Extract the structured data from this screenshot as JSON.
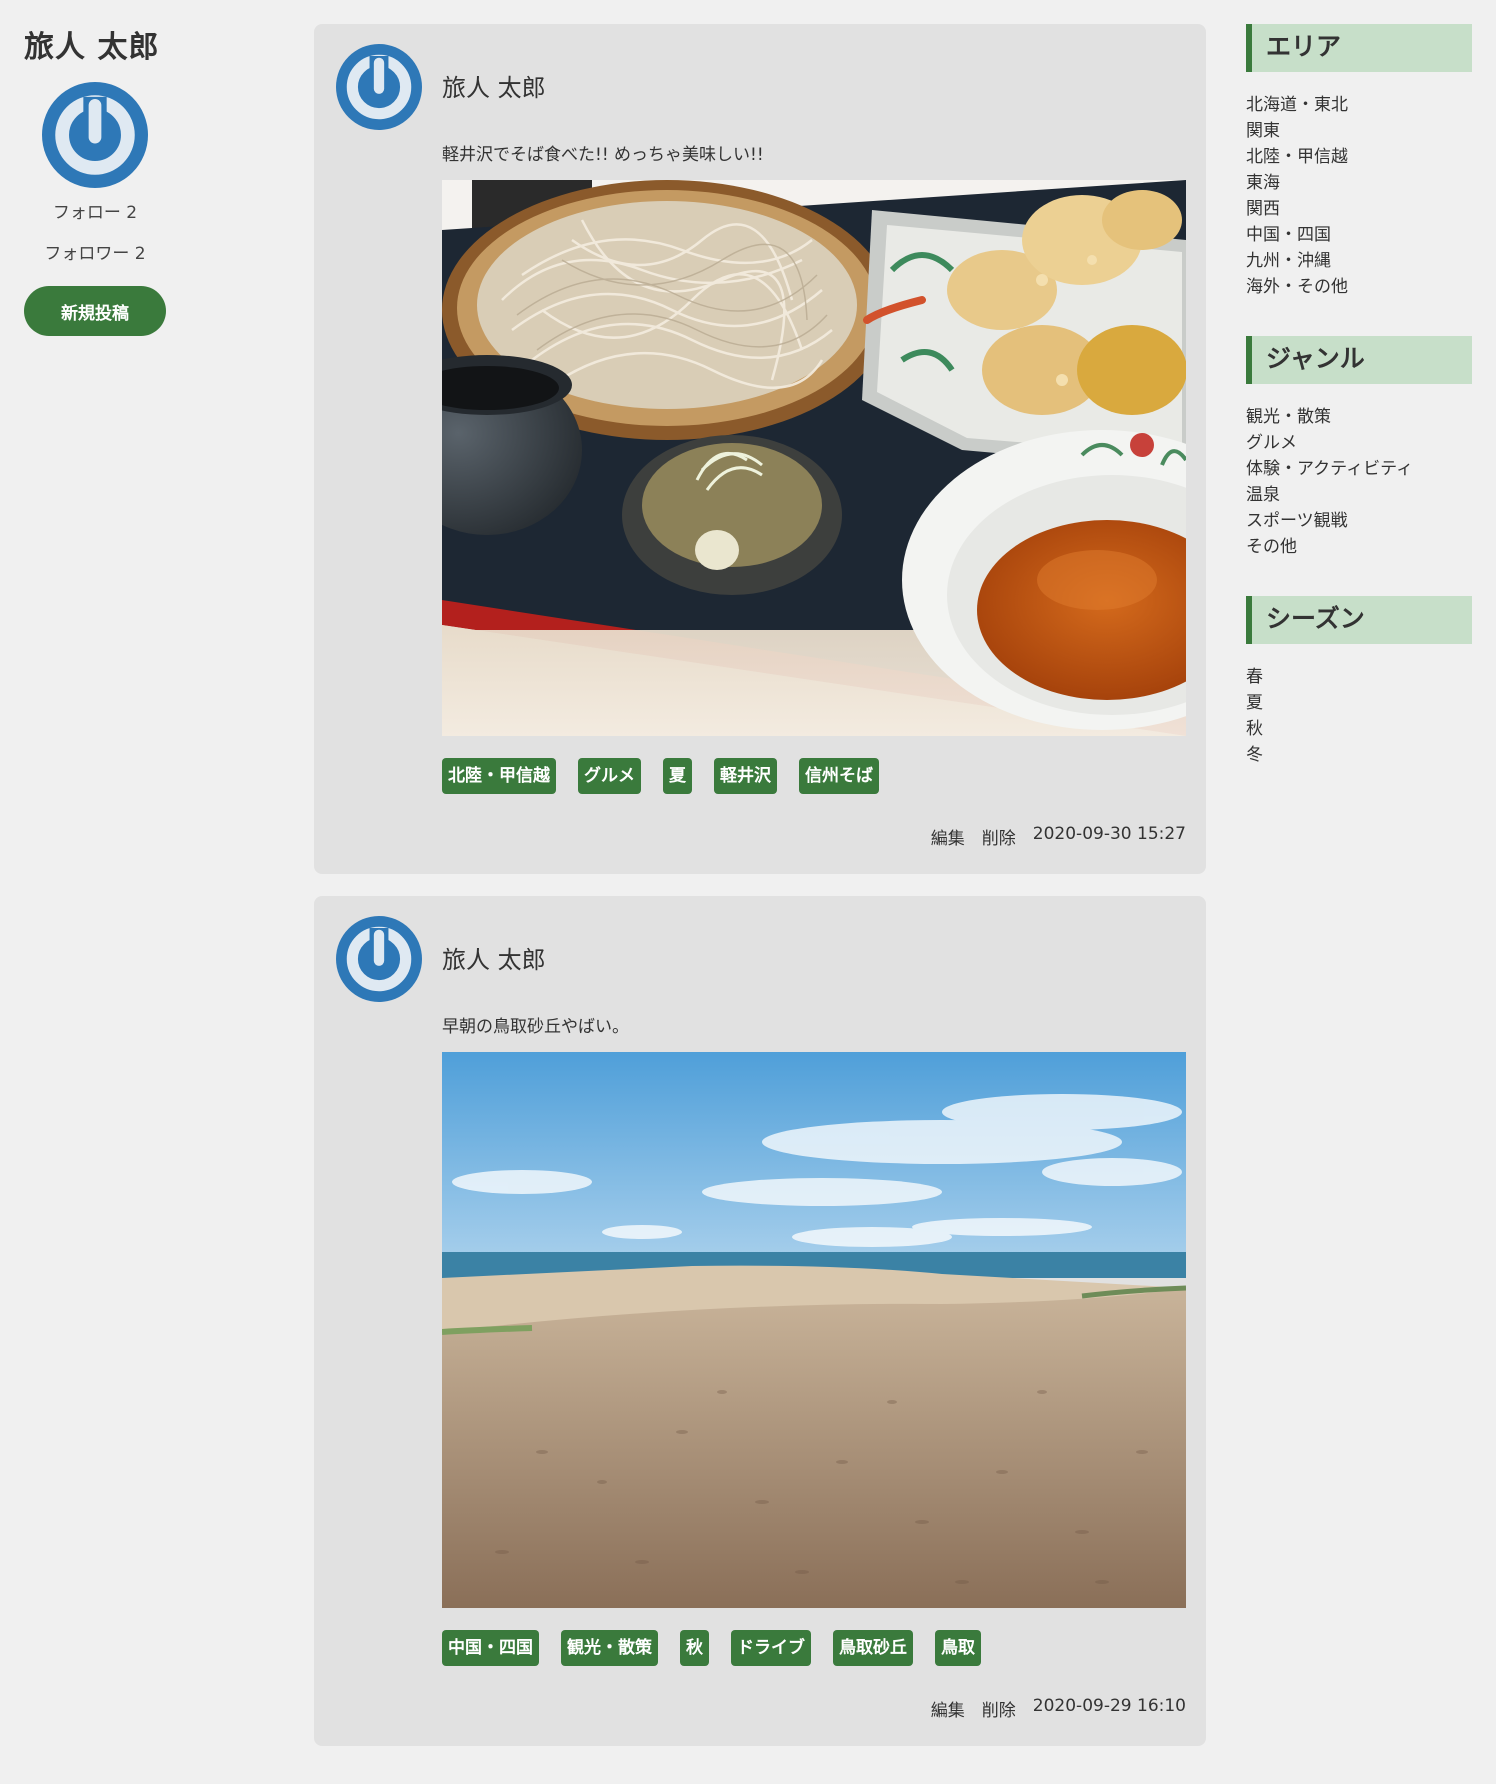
{
  "profile": {
    "name": "旅人 太郎",
    "follow": "フォロー 2",
    "follower": "フォロワー 2",
    "new_post_label": "新規投稿",
    "avatar_icon": "power-logo-icon",
    "avatar_color": "#2e78b7"
  },
  "posts": [
    {
      "author": "旅人 太郎",
      "text": "軽井沢でそば食べた!! めっちゃ美味しい!!",
      "photo": "soba-and-tempura-photo",
      "tags": [
        "北陸・甲信越",
        "グルメ",
        "夏",
        "軽井沢",
        "信州そば"
      ],
      "edit_label": "編集",
      "delete_label": "削除",
      "timestamp": "2020-09-30 15:27"
    },
    {
      "author": "旅人 太郎",
      "text": "早朝の鳥取砂丘やばい。",
      "photo": "tottori-sand-dunes-photo",
      "tags": [
        "中国・四国",
        "観光・散策",
        "秋",
        "ドライブ",
        "鳥取砂丘",
        "鳥取"
      ],
      "edit_label": "編集",
      "delete_label": "削除",
      "timestamp": "2020-09-29 16:10"
    }
  ],
  "sidebar": {
    "area": {
      "title": "エリア",
      "items": [
        "北海道・東北",
        "関東",
        "北陸・甲信越",
        "東海",
        "関西",
        "中国・四国",
        "九州・沖縄",
        "海外・その他"
      ]
    },
    "genre": {
      "title": "ジャンル",
      "items": [
        "観光・散策",
        "グルメ",
        "体験・アクティビティ",
        "温泉",
        "スポーツ観戦",
        "その他"
      ]
    },
    "season": {
      "title": "シーズン",
      "items": [
        "春",
        "夏",
        "秋",
        "冬"
      ]
    }
  },
  "colors": {
    "accent": "#3a7a3c",
    "heading_bg": "#c7dfc9",
    "card_bg": "#e1e1e1",
    "page_bg": "#f0f0f0"
  }
}
